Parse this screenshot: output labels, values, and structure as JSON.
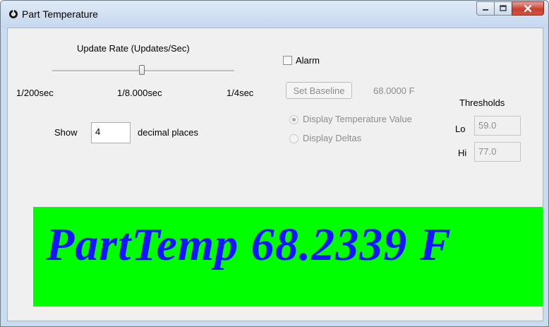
{
  "window": {
    "title": "Part Temperature",
    "icon": "thermometer-app-icon",
    "controls": [
      "minimize-icon",
      "maximize-icon",
      "close-icon"
    ]
  },
  "update_rate": {
    "label": "Update Rate (Updates/Sec)",
    "min_label": "1/200sec",
    "current_label": "1/8.000sec",
    "max_label": "1/4sec"
  },
  "decimals": {
    "show_label": "Show",
    "value": "4",
    "suffix_label": "decimal places"
  },
  "alarm": {
    "label": "Alarm",
    "checked": false
  },
  "baseline": {
    "button_label": "Set Baseline",
    "value": "68.0000 F"
  },
  "display_mode": {
    "options": [
      "Display Temperature Value",
      "Display Deltas"
    ],
    "selected": "Display Temperature Value"
  },
  "thresholds": {
    "title": "Thresholds",
    "lo_label": "Lo",
    "lo_value": "59.0",
    "hi_label": "Hi",
    "hi_value": "77.0"
  },
  "readout": {
    "text": "PartTemp 68.2339 F",
    "background_color": "#00ff00",
    "text_color": "#1515ff"
  }
}
